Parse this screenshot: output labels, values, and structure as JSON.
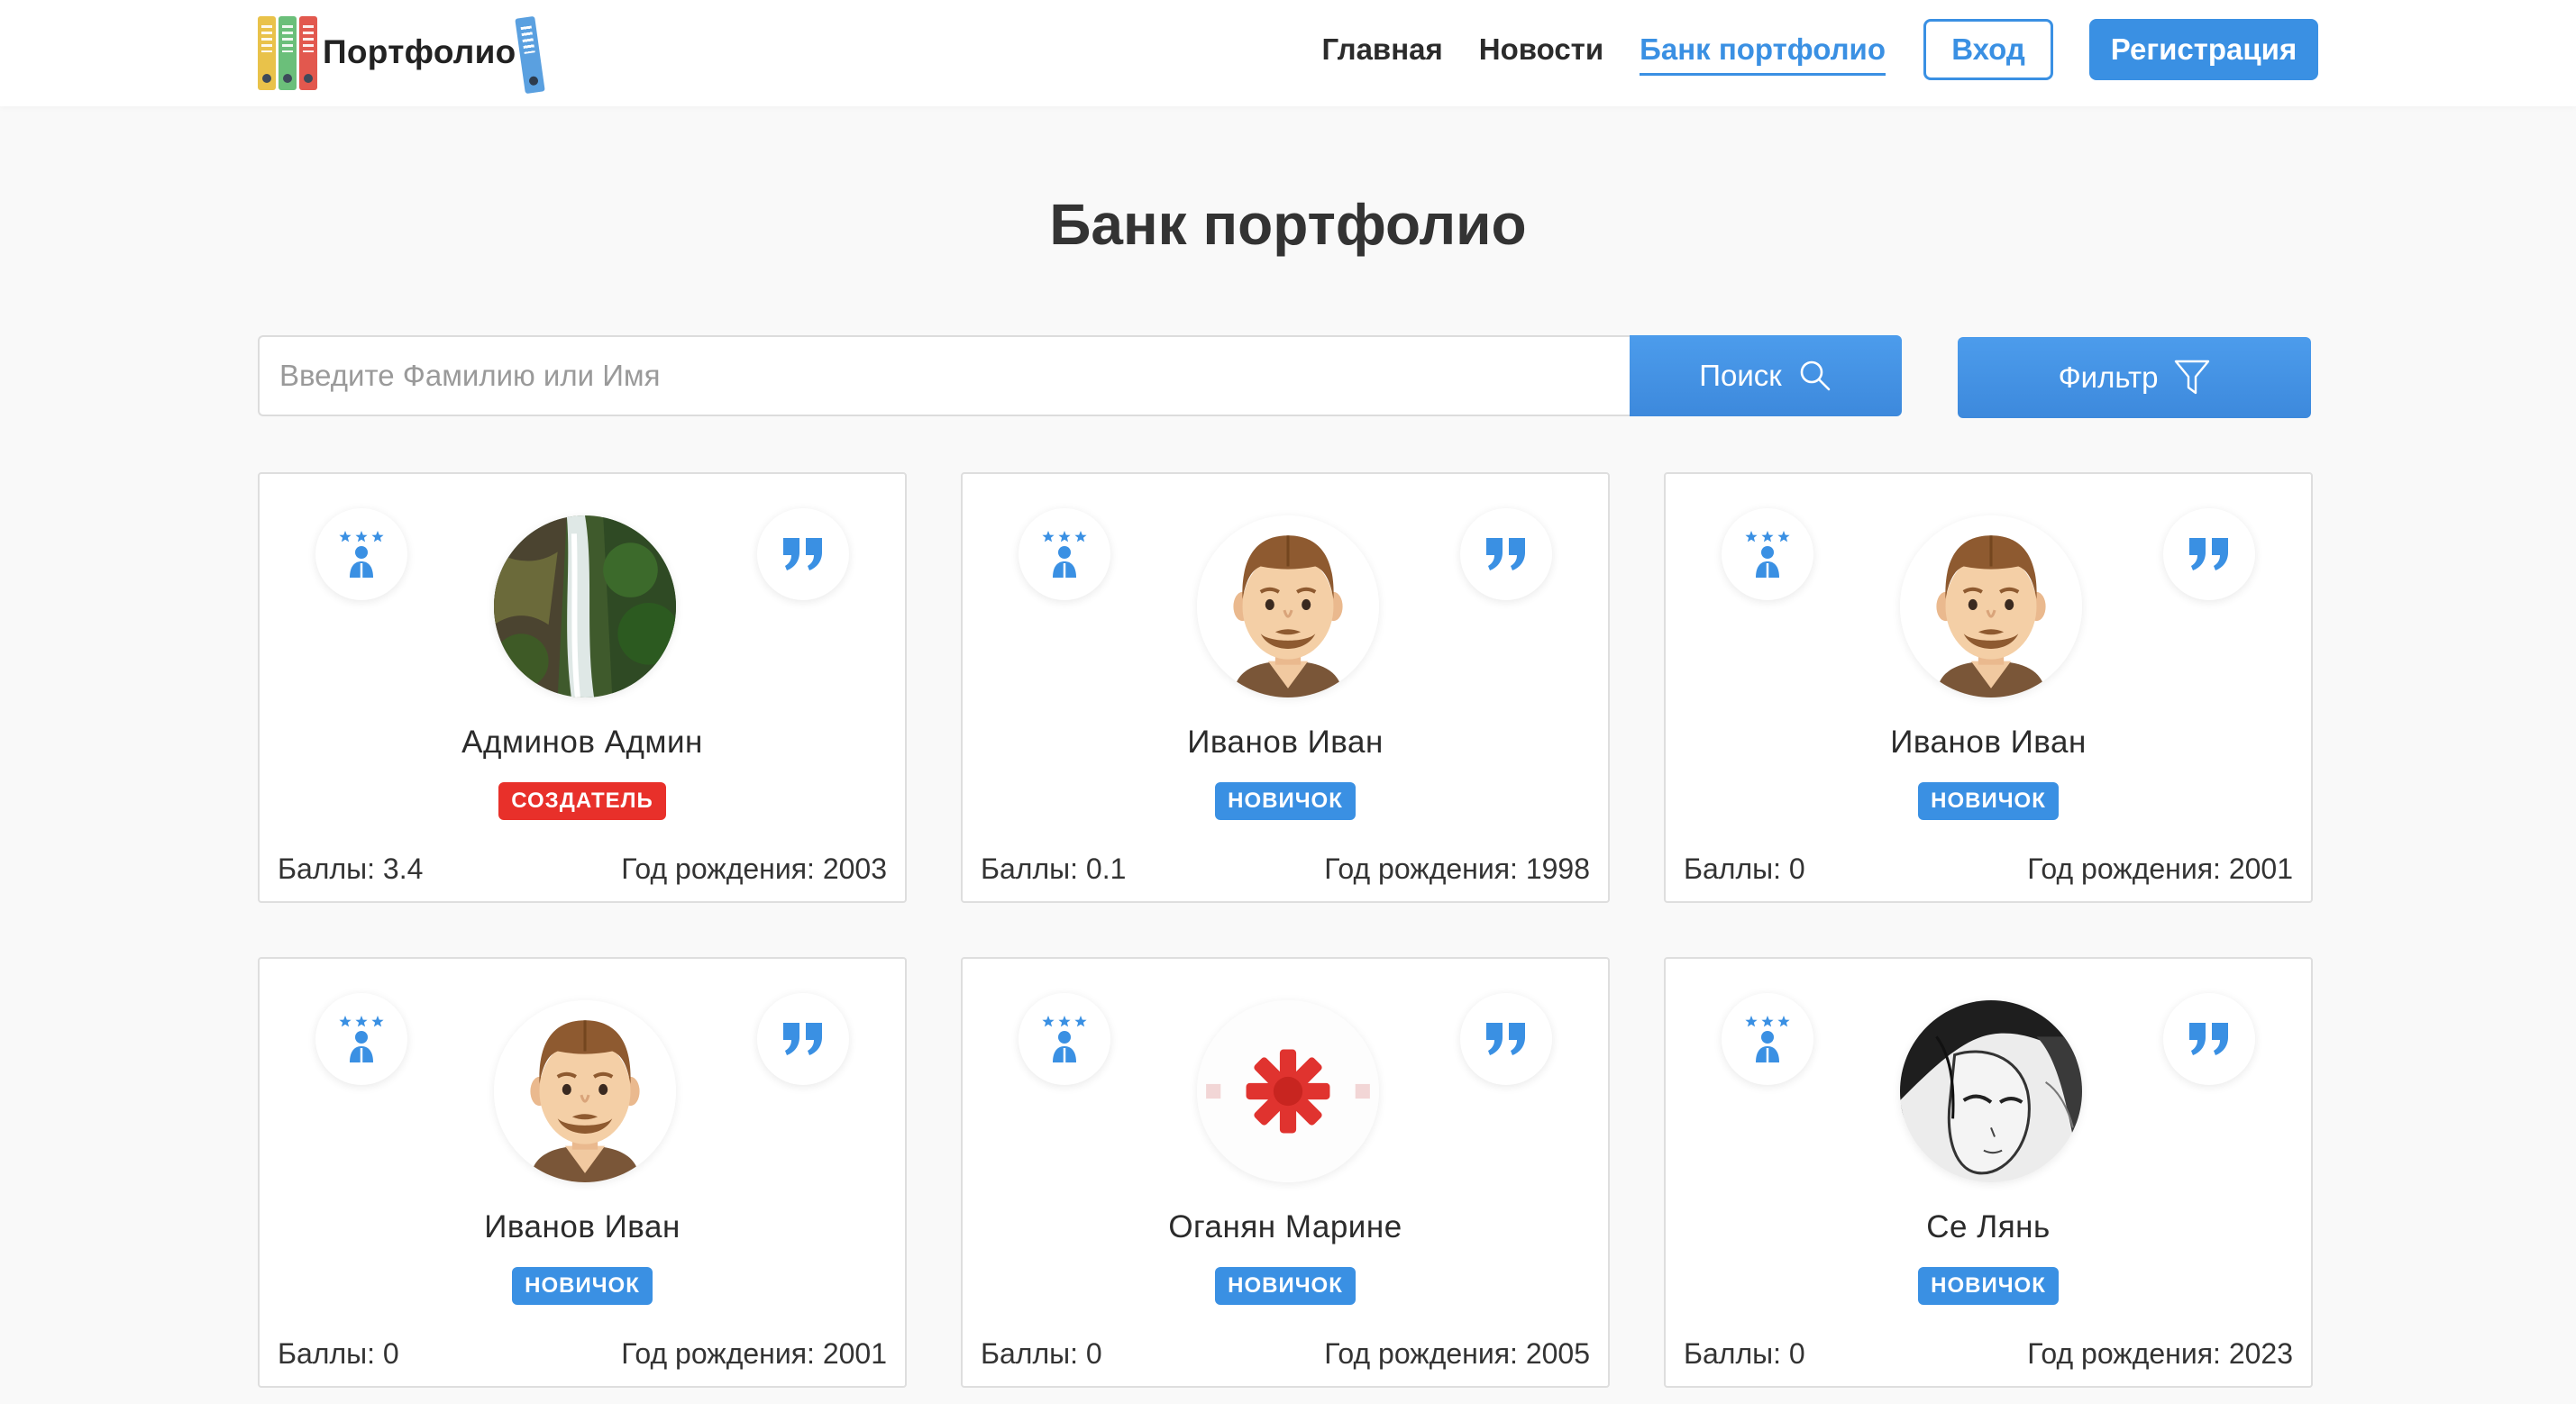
{
  "header": {
    "logo_text": "Портфолио",
    "nav": [
      {
        "label": "Главная",
        "active": false
      },
      {
        "label": "Новости",
        "active": false
      },
      {
        "label": "Банк портфолио",
        "active": true
      }
    ],
    "login_label": "Вход",
    "register_label": "Регистрация"
  },
  "page": {
    "title": "Банк портфолио"
  },
  "search": {
    "placeholder": "Введите Фамилию или Имя",
    "value": "",
    "search_label": "Поиск",
    "filter_label": "Фильтр"
  },
  "colors": {
    "accent": "#3a90e3",
    "badge_creator": "#e8302a",
    "badge_novice": "#3a90e3"
  },
  "cards": [
    {
      "name": "Админов Админ",
      "badge": "СОЗДАТЕЛЬ",
      "badge_type": "creator",
      "score": "Баллы: 3.4",
      "birth": "Год рождения: 2003",
      "avatar": "waterfall-photo"
    },
    {
      "name": "Иванов Иван",
      "badge": "НОВИЧОК",
      "badge_type": "novice",
      "score": "Баллы: 0.1",
      "birth": "Год рождения: 1998",
      "avatar": "default-man"
    },
    {
      "name": "Иванов Иван",
      "badge": "НОВИЧОК",
      "badge_type": "novice",
      "score": "Баллы: 0",
      "birth": "Год рождения: 2001",
      "avatar": "default-man"
    },
    {
      "name": "Иванов Иван",
      "badge": "НОВИЧОК",
      "badge_type": "novice",
      "score": "Баллы: 0",
      "birth": "Год рождения: 2001",
      "avatar": "default-man"
    },
    {
      "name": "Оганян Марине",
      "badge": "НОВИЧОК",
      "badge_type": "novice",
      "score": "Баллы: 0",
      "birth": "Год рождения: 2005",
      "avatar": "red-ornament"
    },
    {
      "name": "Се Лянь",
      "badge": "НОВИЧОК",
      "badge_type": "novice",
      "score": "Баллы: 0",
      "birth": "Год рождения: 2023",
      "avatar": "anime-sketch"
    }
  ]
}
